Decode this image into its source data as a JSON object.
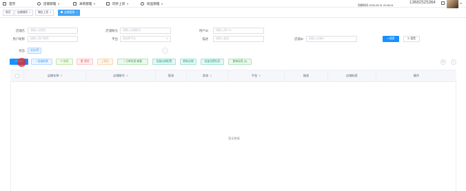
{
  "topnav": {
    "items": [
      {
        "label": "首页"
      },
      {
        "label": "店铺管理"
      },
      {
        "label": "采购管理"
      },
      {
        "label": "同步上货"
      },
      {
        "label": "商品管理"
      }
    ],
    "login_time": "到期时间 2026-09-31 20:28:24",
    "phone": "13682525364"
  },
  "tags": [
    {
      "label": "首页",
      "active": false
    },
    {
      "label": "店铺铺货",
      "active": false
    },
    {
      "label": "铺位上货",
      "active": false
    },
    {
      "label": "店铺管理",
      "active": true
    }
  ],
  "search": {
    "shop_name": {
      "label": "店铺名",
      "placeholder": "请输入店铺名"
    },
    "shop_account": {
      "label": "店铺账号",
      "placeholder": "请输入店铺账号"
    },
    "user_id": {
      "label": "用户ID",
      "placeholder": "请输入用户ID"
    },
    "user_nickname": {
      "label": "用户昵称",
      "placeholder": "请输入用户昵称"
    },
    "platform": {
      "label": "平台",
      "placeholder": "请选择平台"
    },
    "description": {
      "label": "描述",
      "placeholder": "请输入描述"
    },
    "shop_id": {
      "label": "店铺ID",
      "placeholder": "请输入店铺ID"
    },
    "status": {
      "label": "状态",
      "value": "启动/停"
    },
    "search_button": "搜索",
    "reset_button": "重置",
    "collapse_icon": "chevron-up"
  },
  "toolbar": {
    "buttons": [
      "新增",
      "批量新增",
      "修改",
      "删除",
      "导出",
      "订单信息/查看",
      "批量店铺配置",
      "刷新店铺",
      "批量设置标签",
      "更新标签 (3)"
    ],
    "right_icons": [
      "refresh-icon",
      "search-icon"
    ]
  },
  "table": {
    "columns": [
      "店铺名称",
      "店铺账号",
      "登录",
      "状态",
      "平台",
      "描述",
      "店铺标签",
      "操作"
    ],
    "empty_text": "暂无数据"
  },
  "colors": {
    "primary": "#1890ff",
    "active_tag": "#42a5f5",
    "cursor": "#e62828"
  }
}
